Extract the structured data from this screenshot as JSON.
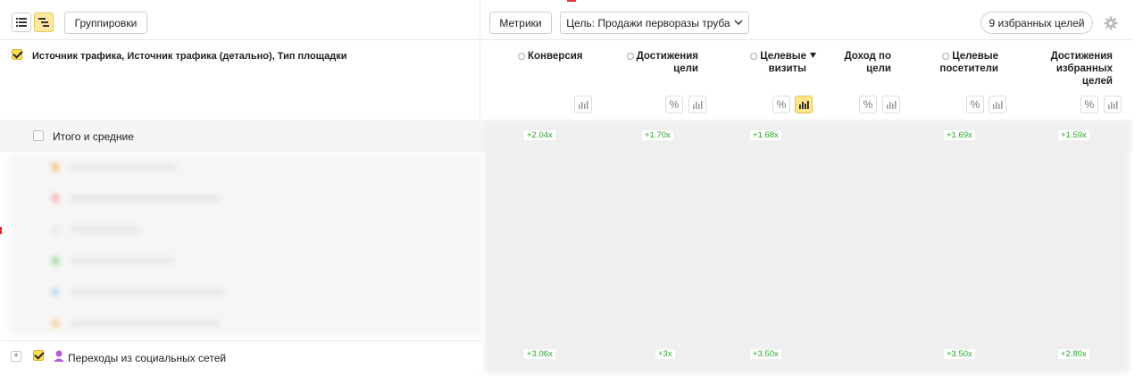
{
  "toolbar": {
    "groupings_label": "Группировки",
    "metrics_label": "Метрики",
    "goal_label": "Цель: Продажи перворазы труба",
    "favorites_label": "9 избранных целей"
  },
  "table": {
    "dimension_header": "Источник трафика, Источник трафика (детально), Тип площадки",
    "columns": [
      {
        "label_line1": "Конверсия",
        "label_line2": "",
        "label_line3": ""
      },
      {
        "label_line1": "Достижения",
        "label_line2": "цели",
        "label_line3": ""
      },
      {
        "label_line1": "Целевые",
        "label_line2": "визиты",
        "label_line3": ""
      },
      {
        "label_line1": "Доход по",
        "label_line2": "цели",
        "label_line3": ""
      },
      {
        "label_line1": "Целевые",
        "label_line2": "посетители",
        "label_line3": ""
      },
      {
        "label_line1": "Достижения",
        "label_line2": "избранных",
        "label_line3": "целей"
      }
    ],
    "percent_symbol": "%",
    "totals_label": "Итого и средние",
    "totals_multipliers": [
      "+2.04x",
      "+1.70x",
      "+1.68x",
      "+1.69x",
      "+1.59x"
    ],
    "social_label": "Переходы из социальных сетей",
    "social_multipliers": [
      "+3.06x",
      "+3x",
      "+3.50x",
      "+3.50x",
      "+2.80x"
    ]
  }
}
